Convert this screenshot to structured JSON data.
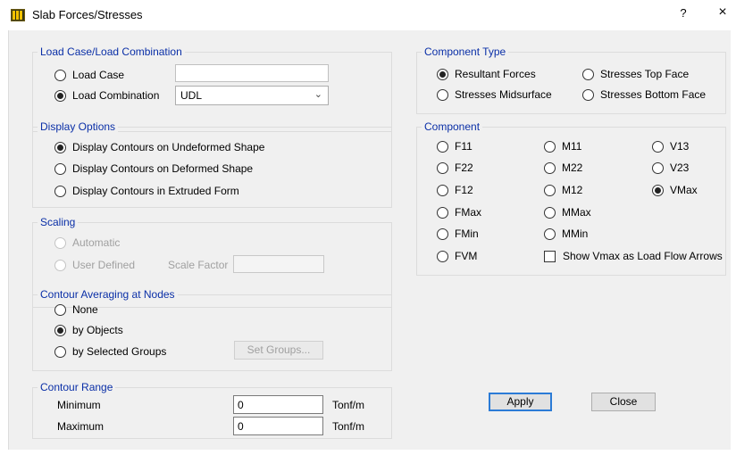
{
  "window": {
    "title": "Slab Forces/Stresses",
    "help": "?",
    "close": "×"
  },
  "load_case_group": {
    "title": "Load Case/Load Combination",
    "load_case_label": "Load Case",
    "load_case_value": "",
    "load_combination_label": "Load Combination",
    "load_combination_value": "UDL",
    "selected": "Load Combination"
  },
  "display_options": {
    "title": "Display Options",
    "options": [
      "Display Contours on Undeformed Shape",
      "Display Contours on Deformed Shape",
      "Display Contours in Extruded Form"
    ],
    "selected": "Display Contours on Undeformed Shape"
  },
  "scaling": {
    "title": "Scaling",
    "automatic": "Automatic",
    "user_defined": "User Defined",
    "scale_factor_label": "Scale Factor",
    "scale_factor_value": ""
  },
  "contour_averaging": {
    "title": "Contour Averaging at Nodes",
    "none": "None",
    "by_objects": "by Objects",
    "by_selected_groups": "by Selected Groups",
    "set_groups": "Set Groups...",
    "selected": "by Objects"
  },
  "contour_range": {
    "title": "Contour Range",
    "minimum_label": "Minimum",
    "minimum_value": "0",
    "maximum_label": "Maximum",
    "maximum_value": "0",
    "unit_min": "Tonf/m",
    "unit_max": "Tonf/m"
  },
  "component_type": {
    "title": "Component Type",
    "resultant_forces": "Resultant Forces",
    "stresses_top": "Stresses Top Face",
    "stresses_mid": "Stresses Midsurface",
    "stresses_bottom": "Stresses Bottom Face",
    "selected": "Resultant Forces"
  },
  "component": {
    "title": "Component",
    "col1": [
      "F11",
      "F22",
      "F12",
      "FMax",
      "FMin",
      "FVM"
    ],
    "col2": [
      "M11",
      "M22",
      "M12",
      "MMax",
      "MMin"
    ],
    "col3": [
      "V13",
      "V23",
      "VMax"
    ],
    "selected": "VMax",
    "show_vmax_label": "Show Vmax as Load Flow Arrows",
    "show_vmax_checked": false
  },
  "buttons": {
    "apply": "Apply",
    "close": "Close"
  }
}
